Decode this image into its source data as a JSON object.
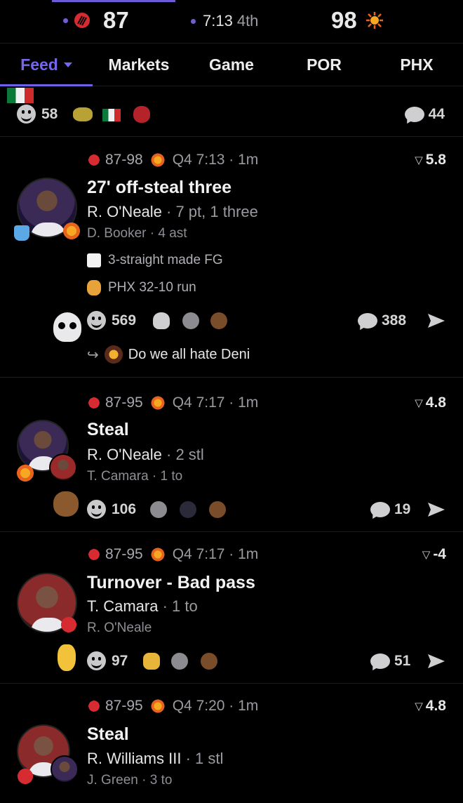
{
  "scoreboard": {
    "away_score": "87",
    "clock": "7:13",
    "period": "4th",
    "home_score": "98"
  },
  "tabs": [
    {
      "label": "Feed"
    },
    {
      "label": "Markets"
    },
    {
      "label": "Game"
    },
    {
      "label": "POR"
    },
    {
      "label": "PHX"
    }
  ],
  "top_reactions": {
    "smiley_count": "58",
    "comment_count": "44"
  },
  "cards": [
    {
      "score": "87-98",
      "time": "Q4 7:13 · 1m",
      "odds": "5.8",
      "title": "27' off-steal three",
      "primary_name": "R. O'Neale",
      "primary_stat": " · 7 pt, 1 three",
      "secondary": "D. Booker · 4 ast",
      "tags": [
        "3-straight made FG",
        "PHX 32-10 run"
      ],
      "smiley_count": "569",
      "comment_count": "388",
      "reply_text": "Do we all hate Deni"
    },
    {
      "score": "87-95",
      "time": "Q4 7:17 · 1m",
      "odds": "4.8",
      "title": "Steal",
      "primary_name": "R. O'Neale",
      "primary_stat": " · 2 stl",
      "secondary": "T. Camara · 1 to",
      "smiley_count": "106",
      "comment_count": "19"
    },
    {
      "score": "87-95",
      "time": "Q4 7:17 · 1m",
      "odds": "-4",
      "title": "Turnover - Bad pass",
      "primary_name": "T. Camara",
      "primary_stat": " · 1 to",
      "secondary": "R. O'Neale",
      "smiley_count": "97",
      "comment_count": "51"
    },
    {
      "score": "87-95",
      "time": "Q4 7:20 · 1m",
      "odds": "4.8",
      "title": "Steal",
      "primary_name": "R. Williams III",
      "primary_stat": " · 1 stl",
      "secondary": "J. Green · 3 to"
    }
  ],
  "colors": {
    "accent": "#7466ee",
    "background": "#000000",
    "blazers_red": "#d72b32",
    "suns_orange": "#e8641c"
  }
}
